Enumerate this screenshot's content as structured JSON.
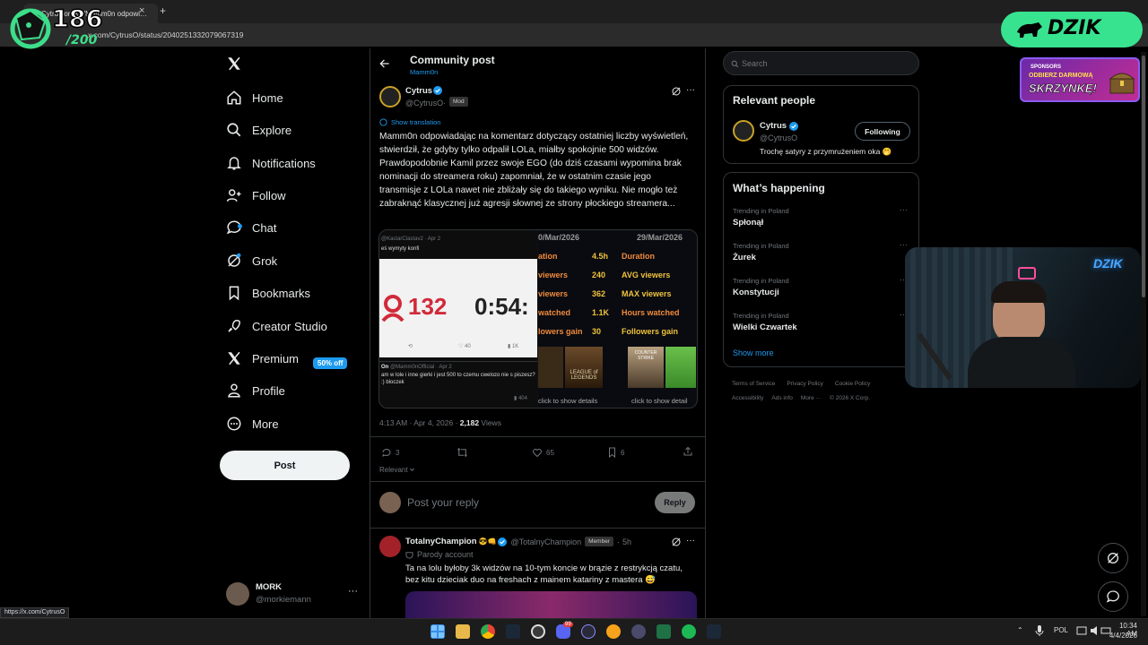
{
  "browser": {
    "tab_title": "Cytrus on X: \"Mamm0n odpowi…",
    "tab_close": "×",
    "new_tab": "+",
    "url": "x.com/CytrusO/status/2040251332079067319",
    "status_bar_url": "https://x.com/CytrusO"
  },
  "overlay": {
    "counter_value": "186",
    "counter_goal": "/200",
    "brand": "DZIK",
    "promo_line1": "SPONSORS",
    "promo_line2": "ODBIERZ DARMOWĄ",
    "promo_line3": "SKRZYNKĘ!",
    "webcam_sign": "DZIK"
  },
  "nav": {
    "items": [
      {
        "label": "Home",
        "icon": "home-icon"
      },
      {
        "label": "Explore",
        "icon": "search-icon"
      },
      {
        "label": "Notifications",
        "icon": "bell-icon"
      },
      {
        "label": "Follow",
        "icon": "person-add-icon"
      },
      {
        "label": "Chat",
        "icon": "chat-bubble-icon"
      },
      {
        "label": "Grok",
        "icon": "grok-icon"
      },
      {
        "label": "Bookmarks",
        "icon": "bookmark-icon"
      },
      {
        "label": "Creator Studio",
        "icon": "rocket-icon"
      },
      {
        "label": "Premium",
        "icon": "x-logo-icon"
      },
      {
        "label": "Profile",
        "icon": "person-icon"
      },
      {
        "label": "More",
        "icon": "more-circle-icon"
      }
    ],
    "premium_badge": "50% off",
    "post_button": "Post",
    "account": {
      "name": "MORK",
      "handle": "@morkiemann",
      "more": "···"
    }
  },
  "header": {
    "title": "Community post",
    "subtitle": "Mamm0n"
  },
  "post": {
    "author": "Cytrus",
    "handle": "@CytrusO",
    "dot": "·",
    "badge": "Mod",
    "show_translation": "Show translation",
    "text": "Mamm0n odpowiadając na komentarz dotyczący ostatniej liczby wyświetleń, stwierdził, że gdyby tylko odpalił LOLa, miałby spokojnie 500 widzów. Prawdopodobnie Kamil przez swoje EGO (do dziś czasami wypomina brak nominacji do streamera roku) zapomniał, że w ostatnim czasie jego transmisje z LOLa nawet nie zbliżały się do takiego wyniku. Nie mogło też zabraknąć klasycznej już agresji słownej ze strony płockiego streamera...",
    "time": "4:13 AM · Apr 4, 2026 · ",
    "views_count": "2,182",
    "views_label": " Views",
    "replies": "3",
    "likes": "65",
    "bookmarks": "6",
    "sort": "Relevant",
    "reply_placeholder": "Post your reply",
    "reply_button": "Reply"
  },
  "media": {
    "left_top_handle": "@KastarClastav2 · Apr 2",
    "left_top_text": "eś wymyty konfi",
    "left_big_count": "132",
    "left_big_time": "0:54:",
    "left_likes": "40",
    "left_views": "1K",
    "left_bottom_handle": "@Mamm0nOfficial · Apr 2",
    "left_bottom_handle_prefix": "On",
    "left_bottom_text": "am w lole i inne gierki i jest 500 to czemu cwelozo nie s piszesz? :) bloczek",
    "left_bottom_views": "404",
    "date_left": "0/Mar/2026",
    "date_right": "29/Mar/2026",
    "stats_labels_left": [
      "ation",
      "viewers",
      "viewers",
      "watched",
      "lowers gain"
    ],
    "stats_values_left": [
      "4.5h",
      "240",
      "362",
      "1.1K",
      "30"
    ],
    "stats_labels_right": [
      "Duration",
      "AVG viewers",
      "MAX viewers",
      "Hours watched",
      "Followers gain"
    ],
    "game_left": "LEAGUE of LEGENDS",
    "game_right": "COUNTER STRIKE",
    "click_left": "click to show details",
    "click_right": "click to show detail"
  },
  "reply": {
    "author": "TotalnyChampion",
    "emojis": "😎👊",
    "handle": "@TotalnyChampion",
    "badge": "Member",
    "time": "5h",
    "dot": "·",
    "parody": "Parody account",
    "text": "Ta na lolu byłoby 3k widzów na 10-tym koncie w brązie z restrykcją czatu, bez kitu dzieciak duo na freshach z mainem katariny z mastera 😅"
  },
  "right": {
    "search_placeholder": "Search",
    "relevant_title": "Relevant people",
    "person_name": "Cytrus",
    "person_handle": "@CytrusO",
    "following_button": "Following",
    "person_bio": "Trochę satyry z przymrużeniem oka 🤭",
    "happening_title": "What’s happening",
    "trends": [
      {
        "meta": "Trending in Poland",
        "title": "Spłonął"
      },
      {
        "meta": "Trending in Poland",
        "title": "Żurek"
      },
      {
        "meta": "Trending in Poland",
        "title": "Konstytucji"
      },
      {
        "meta": "Trending in Poland",
        "title": "Wielki Czwartek"
      }
    ],
    "show_more": "Show more",
    "footer_line1": [
      "Terms of Service",
      "Privacy Policy",
      "Cookie Policy"
    ],
    "footer_line2": [
      "Accessibility",
      "Ads info",
      "More ···",
      "© 2026 X Corp."
    ]
  },
  "taskbar": {
    "lang": "POL",
    "time": "10:34 AM",
    "date": "4/4/2026",
    "discord_badge": "99"
  },
  "colors": {
    "accent_blue": "#1d9bf0",
    "dzik_green": "#38e38f",
    "text": "#e7e9ea",
    "muted": "#71767b",
    "border": "#2f3336"
  }
}
